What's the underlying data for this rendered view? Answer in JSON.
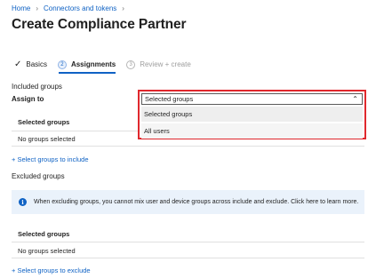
{
  "breadcrumb": {
    "items": [
      "Home",
      "Connectors and tokens"
    ]
  },
  "page": {
    "title": "Create Compliance Partner"
  },
  "wizard": {
    "steps": [
      {
        "label": "Basics",
        "state": "completed"
      },
      {
        "number": "2",
        "label": "Assignments",
        "state": "active"
      },
      {
        "number": "3",
        "label": "Review + create",
        "state": "disabled"
      }
    ]
  },
  "included": {
    "section_label": "Included groups",
    "assign_label": "Assign to",
    "dropdown": {
      "selected": "Selected groups",
      "options": [
        "Selected groups",
        "All users"
      ]
    },
    "table_header": "Selected groups",
    "empty_text": "No groups selected",
    "link": "+ Select groups to include"
  },
  "excluded": {
    "section_label": "Excluded groups",
    "info_text": "When excluding groups, you cannot mix user and device groups across include and exclude. Click here to learn more.",
    "table_header": "Selected groups",
    "empty_text": "No groups selected",
    "link": "+ Select groups to exclude"
  },
  "colors": {
    "accent": "#0f62c4",
    "highlight_border": "#e0282d",
    "info_background": "#eaf2fb"
  }
}
